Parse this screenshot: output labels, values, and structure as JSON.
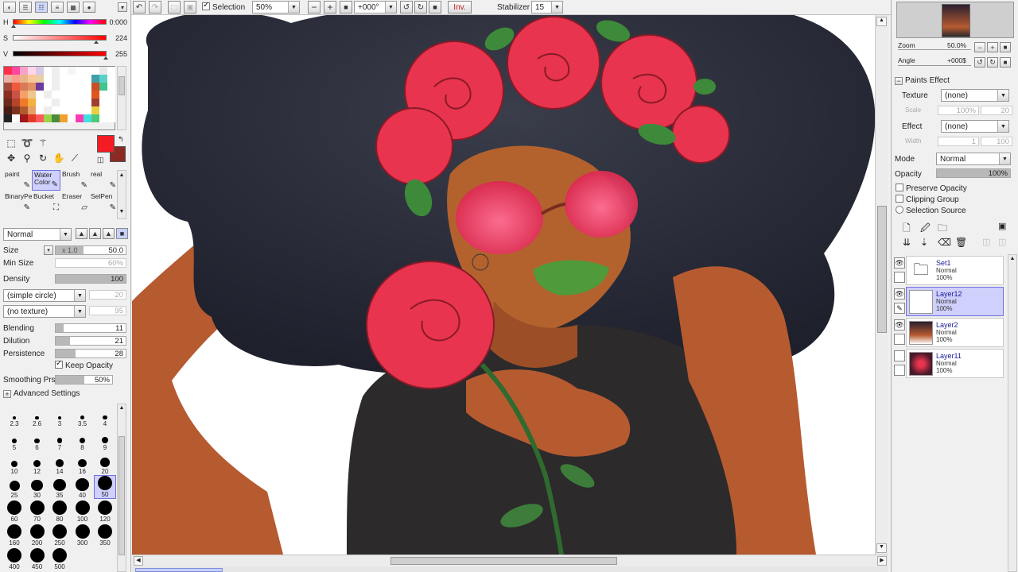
{
  "color": {
    "h_label": "H",
    "h_value": "0:000",
    "s_label": "S",
    "s_value": "224",
    "v_label": "V",
    "v_value": "255",
    "fg": "#f41c22",
    "bg": "#8a2a22"
  },
  "swatches": [
    "#ff2f4c",
    "#ff46a0",
    "#f7a3c8",
    "#ffd6ea",
    "#d7c8e8",
    "#ffffff",
    "#eeeeee",
    "#ffffff",
    "#f5f5f5",
    "#ffffff",
    "#ffffff",
    "#ffffff",
    "#e9e9e9",
    "#ffffff",
    "#e8b3a6",
    "#f99e8b",
    "#eab48a",
    "#fac796",
    "#e8d0a6",
    "#ffffff",
    "#eeeeee",
    "#ffffff",
    "#ffffff",
    "#ffffff",
    "#ffffff",
    "#3ea0a6",
    "#5ad0c7",
    "#ffffff",
    "#a64b3c",
    "#ef5a3d",
    "#d87a58",
    "#e28e66",
    "#6b3a9a",
    "#ffffff",
    "#eeeeee",
    "#ffffff",
    "#ffffff",
    "#ffffff",
    "#ffffff",
    "#c94d28",
    "#42c48a",
    "#ffffff",
    "#8a2c1e",
    "#c6524a",
    "#f4a066",
    "#eec78e",
    "#ffffff",
    "#eeeeee",
    "#ffffff",
    "#ffffff",
    "#ffffff",
    "#ffffff",
    "#ffffff",
    "#e2561e",
    "#ffffff",
    "#ffffff",
    "#6b2a1c",
    "#b4452c",
    "#f07a2a",
    "#f4b040",
    "#ffffff",
    "#ffffff",
    "#eeeeee",
    "#ffffff",
    "#ffffff",
    "#ffffff",
    "#ffffff",
    "#a04030",
    "#ffffff",
    "#ffffff",
    "#4a1b12",
    "#7e3220",
    "#b05a2c",
    "#e4a066",
    "#ffffff",
    "#eeeeee",
    "#ffffff",
    "#ffffff",
    "#ffffff",
    "#ffffff",
    "#ffffff",
    "#e8d040",
    "#ffffff",
    "#ffffff",
    "#222222",
    "#ffffff",
    "#a01818",
    "#e43a2a",
    "#ff5a5a",
    "#9bd24a",
    "#4a8c3a",
    "#f0a030",
    "#ffffff",
    "#ff3ab0",
    "#40e0e0",
    "#50c878",
    "#ffffff",
    "#ffffff"
  ],
  "brushes": [
    {
      "label": "paint",
      "icon": "✎"
    },
    {
      "label": "Water Color",
      "icon": "✎"
    },
    {
      "label": "Brush",
      "icon": "✎"
    },
    {
      "label": "real",
      "icon": "✎"
    },
    {
      "label": "BinaryPe",
      "icon": "✎"
    },
    {
      "label": "Bucket",
      "icon": "⛶"
    },
    {
      "label": "Eraser",
      "icon": "▱"
    },
    {
      "label": "SelPen",
      "icon": "✎"
    }
  ],
  "brush_settings": {
    "blend_mode": "Normal",
    "size_label": "Size",
    "size_mult": "x 1.0",
    "size_value": "50.0",
    "minsize_label": "Min Size",
    "minsize_value": "60%",
    "density_label": "Density",
    "density_value": "100",
    "shape": "(simple circle)",
    "shape_value": "20",
    "texture": "(no texture)",
    "texture_value": "95",
    "blending_label": "Blending",
    "blending_value": "11",
    "dilution_label": "Dilution",
    "dilution_value": "21",
    "persistence_label": "Persistence",
    "persistence_value": "28",
    "keep_opacity": "Keep Opacity",
    "smoothing_label": "Smoothing Prs",
    "smoothing_value": "50%",
    "advanced": "Advanced Settings"
  },
  "brush_sizes": [
    "2.3",
    "2.6",
    "3",
    "3.5",
    "4",
    "5",
    "6",
    "7",
    "8",
    "9",
    "10",
    "12",
    "14",
    "16",
    "20",
    "25",
    "30",
    "35",
    "40",
    "50",
    "60",
    "70",
    "80",
    "100",
    "120",
    "160",
    "200",
    "250",
    "300",
    "350",
    "400",
    "450",
    "500"
  ],
  "toolbar": {
    "selection_label": "Selection",
    "zoom": "50%",
    "rotation": "+000°",
    "inv": "Inv.",
    "stabilizer_label": "Stabilizer",
    "stabilizer_value": "15"
  },
  "navigator": {
    "zoom_label": "Zoom",
    "zoom_value": "50.0%",
    "angle_label": "Angle",
    "angle_value": "+000$"
  },
  "paints_effect": {
    "title": "Paints Effect",
    "texture_label": "Texture",
    "texture_value": "(none)",
    "scale_label": "Scale",
    "scale_pct": "100%",
    "scale_value": "20",
    "effect_label": "Effect",
    "effect_value": "(none)",
    "width_label": "Width",
    "width_value": "1",
    "width_pct": "100"
  },
  "layer_props": {
    "mode_label": "Mode",
    "mode_value": "Normal",
    "opacity_label": "Opacity",
    "opacity_value": "100%",
    "preserve_opacity": "Preserve Opacity",
    "clipping_group": "Clipping Group",
    "selection_source": "Selection Source"
  },
  "layers": [
    {
      "name": "Set1",
      "mode": "Normal",
      "opacity": "100%",
      "type": "folder"
    },
    {
      "name": "Layer12",
      "mode": "Normal",
      "opacity": "100%",
      "type": "layer",
      "selected": true
    },
    {
      "name": "Layer2",
      "mode": "Normal",
      "opacity": "100%",
      "type": "layer"
    },
    {
      "name": "Layer11",
      "mode": "Normal",
      "opacity": "100%",
      "type": "layer"
    }
  ]
}
